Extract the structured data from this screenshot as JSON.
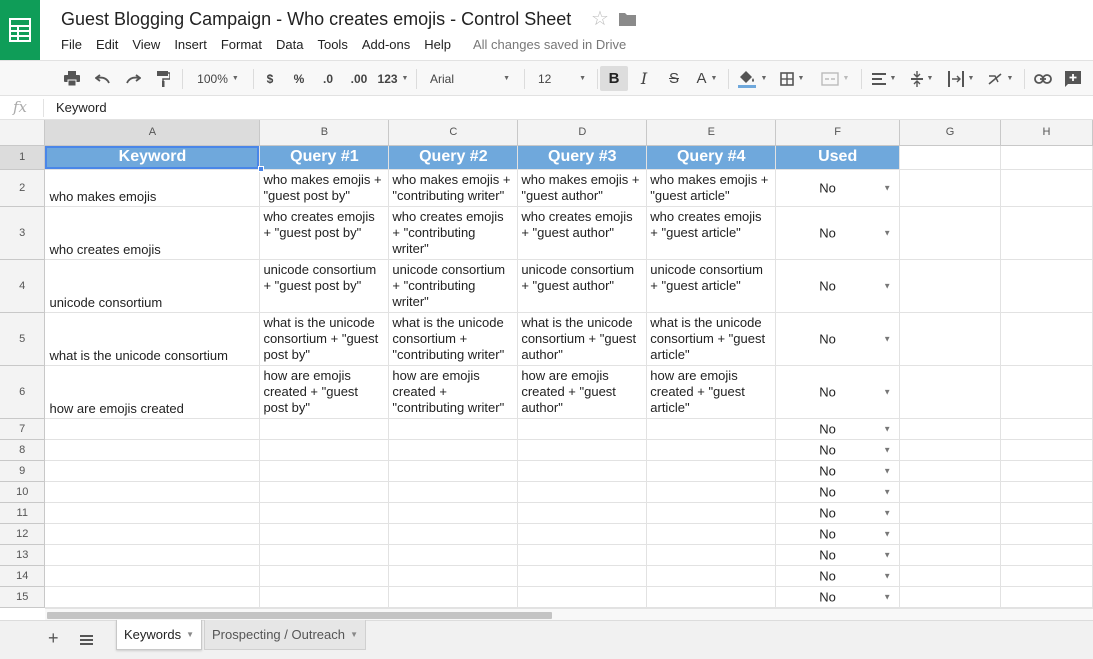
{
  "window": {
    "title": "Guest Blogging Campaign - Who creates emojis - Control Sheet",
    "save_status": "All changes saved in Drive"
  },
  "menu": [
    "File",
    "Edit",
    "View",
    "Insert",
    "Format",
    "Data",
    "Tools",
    "Add-ons",
    "Help"
  ],
  "toolbar": {
    "zoom": "100%",
    "currency": "$",
    "percent": "%",
    "decrease_decimals": ".0",
    "increase_decimals": ".00",
    "more_formats": "123",
    "font": "Arial",
    "font_size": "12",
    "bold": "B",
    "italic": "I",
    "strikethrough": "S",
    "text_color": "A",
    "colors": {
      "fill_underline": "#6fa8dc",
      "header_fill": "#6fa8dc",
      "brand": "#0f9d58"
    },
    "icons": [
      "print-icon",
      "undo-icon",
      "redo-icon",
      "paint-format-icon",
      "fill-color-icon",
      "borders-icon",
      "merge-cells-icon",
      "horizontal-align-icon",
      "vertical-align-icon",
      "text-wrap-icon",
      "text-rotation-icon",
      "insert-link-icon",
      "insert-comment-icon"
    ]
  },
  "formula_bar": {
    "fx": "fx",
    "value": "Keyword"
  },
  "grid": {
    "column_letters": [
      "A",
      "B",
      "C",
      "D",
      "E",
      "F",
      "G",
      "H"
    ],
    "header_row": [
      "Keyword",
      "Query #1",
      "Query #2",
      "Query #3",
      "Query #4",
      "Used"
    ],
    "rows": [
      {
        "num": "2",
        "keyword": "who makes emojis",
        "queries": [
          "who makes emojis + \"guest post by\"",
          "who makes emojis + \"contributing writer\"",
          "who makes emojis + \"guest author\"",
          "who makes emojis + \"guest article\""
        ],
        "used": "No"
      },
      {
        "num": "3",
        "keyword": "who creates emojis",
        "queries": [
          "who creates emojis + \"guest post by\"",
          "who creates emojis + \"contributing writer\"",
          "who creates emojis + \"guest author\"",
          "who creates emojis + \"guest article\""
        ],
        "used": "No"
      },
      {
        "num": "4",
        "keyword": "unicode consortium",
        "queries": [
          "unicode consortium + \"guest post by\"",
          "unicode consortium + \"contributing writer\"",
          "unicode consortium + \"guest author\"",
          "unicode consortium + \"guest article\""
        ],
        "used": "No"
      },
      {
        "num": "5",
        "keyword": "what is the unicode consortium",
        "queries": [
          "what is the unicode consortium + \"guest post by\"",
          "what is the unicode consortium + \"contributing writer\"",
          "what is the unicode consortium + \"guest author\"",
          "what is the unicode consortium + \"guest article\""
        ],
        "used": "No"
      },
      {
        "num": "6",
        "keyword": "how are emojis created",
        "queries": [
          "how are emojis created + \"guest post by\"",
          "how are emojis created + \"contributing writer\"",
          "how are emojis created + \"guest author\"",
          "how are emojis created + \"guest article\""
        ],
        "used": "No"
      }
    ],
    "empty_rows": [
      {
        "num": "7",
        "used": "No"
      },
      {
        "num": "8",
        "used": "No"
      },
      {
        "num": "9",
        "used": "No"
      },
      {
        "num": "10",
        "used": "No"
      },
      {
        "num": "11",
        "used": "No"
      },
      {
        "num": "12",
        "used": "No"
      },
      {
        "num": "13",
        "used": "No"
      },
      {
        "num": "14",
        "used": "No"
      },
      {
        "num": "15",
        "used": "No"
      }
    ],
    "header_row_num": "1"
  },
  "sheets": [
    {
      "label": "Keywords",
      "active": true
    },
    {
      "label": "Prospecting / Outreach",
      "active": false
    }
  ]
}
